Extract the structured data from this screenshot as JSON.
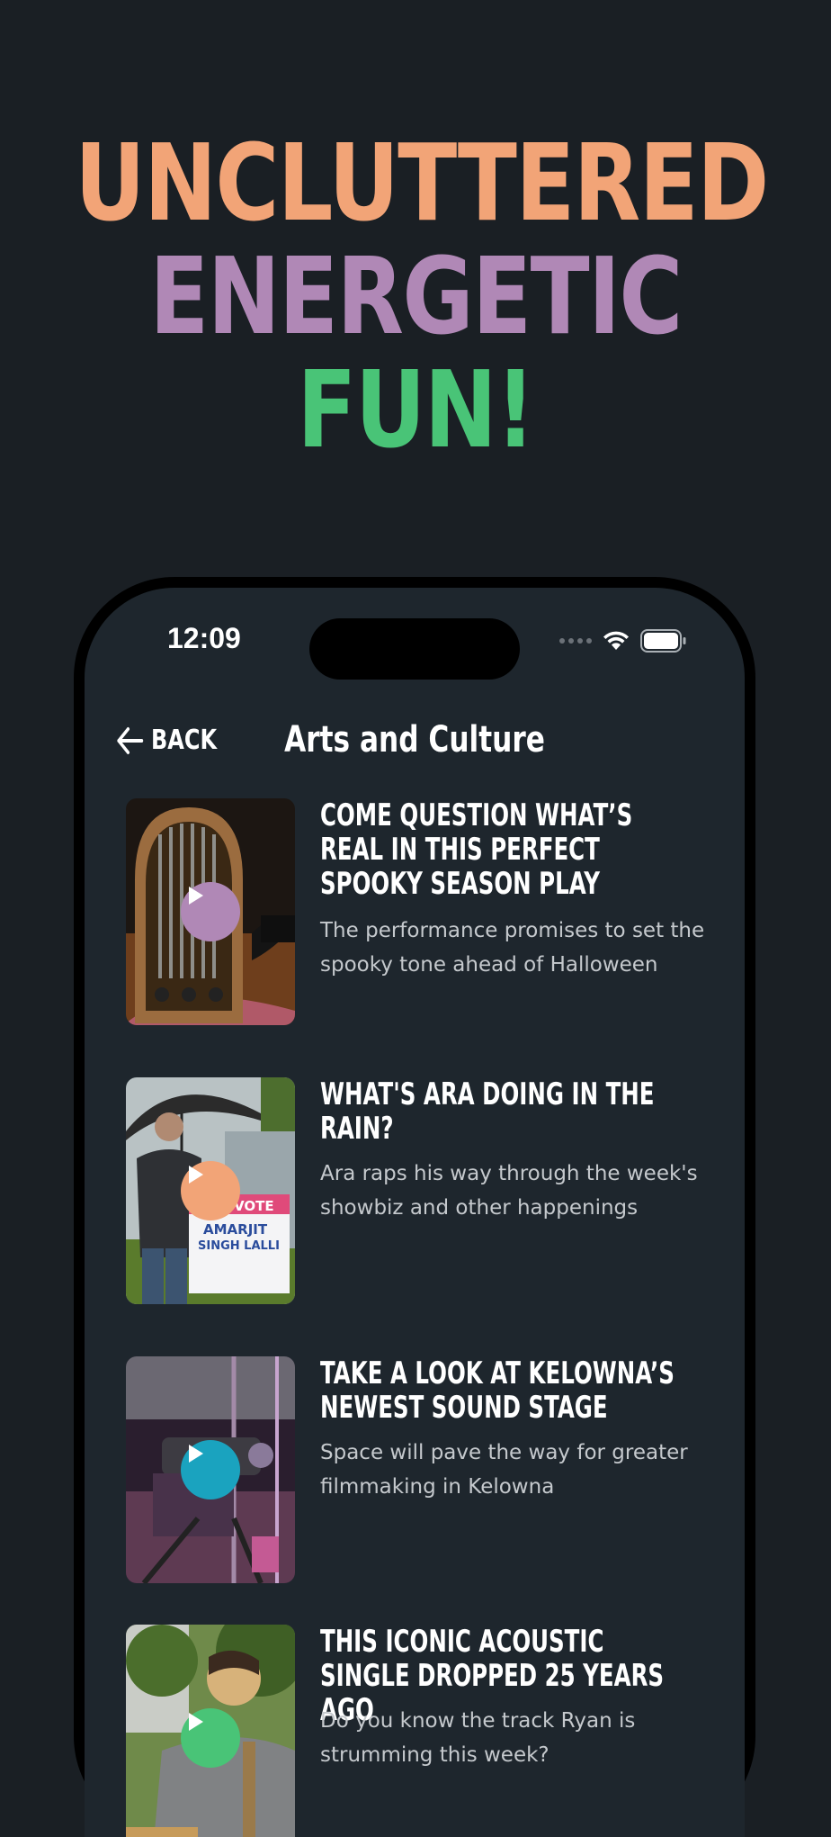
{
  "headline": {
    "line1": "UNCLUTTERED",
    "line2": "ENERGETIC",
    "line3": "FUN!",
    "colors": {
      "line1": "#f2a477",
      "line2": "#b088b6",
      "line3": "#49c477"
    }
  },
  "status_bar": {
    "time": "12:09"
  },
  "nav": {
    "back_label": "BACK",
    "title": "Arts and Culture"
  },
  "articles": [
    {
      "title": "COME QUESTION WHAT’S REAL IN THIS PERFECT SPOOKY SEASON PLAY",
      "description": "The performance promises to set the spooky tone ahead of Halloween",
      "play_color": "#b088b6"
    },
    {
      "title": "WHAT'S ARA DOING IN THE RAIN?",
      "description": "Ara raps his way through the week's showbiz and other happenings",
      "play_color": "#f2a477",
      "sign_text": [
        "VOTE",
        "AMARJIT",
        "SINGH LALLI"
      ]
    },
    {
      "title": "TAKE A LOOK AT KELOWNA’S NEWEST SOUND STAGE",
      "description": "Space will pave the way for greater filmmaking in Kelowna",
      "play_color": "#1aa3bf"
    },
    {
      "title": "THIS ICONIC ACOUSTIC SINGLE DROPPED 25 YEARS AGO",
      "description": "Do you know the track Ryan is strumming this week?",
      "play_color": "#49c477"
    }
  ]
}
